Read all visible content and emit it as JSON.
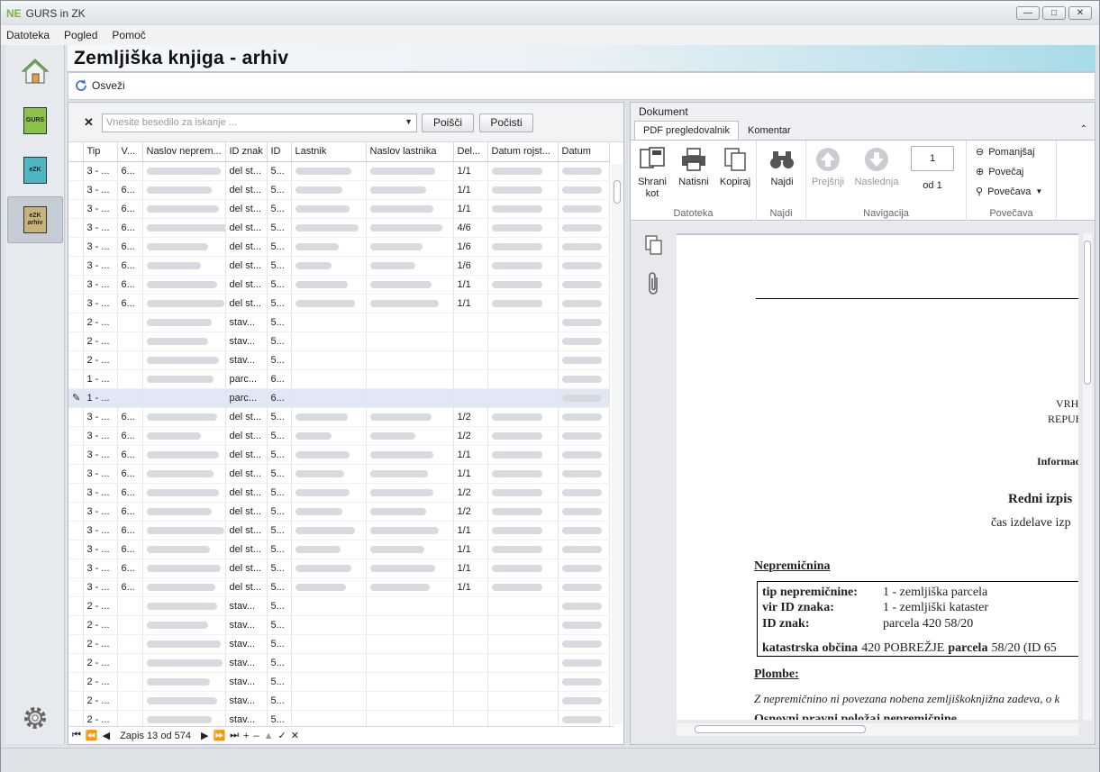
{
  "app": {
    "logo": "NE",
    "title": "GURS in ZK"
  },
  "menu": [
    "Datoteka",
    "Pogled",
    "Pomoč"
  ],
  "nav": {
    "gurs": "GURS",
    "ezk": "eZK",
    "ezk_arhiv_1": "eZK",
    "ezk_arhiv_2": "arhiv"
  },
  "page_title": "Zemljiška knjiga - arhiv",
  "toolbar": {
    "refresh": "Osveži"
  },
  "search": {
    "placeholder": "Vnesite besedilo za iskanje ...",
    "find": "Poišči",
    "clear": "Počisti"
  },
  "table": {
    "columns": [
      "Tip",
      "V...",
      "Naslov neprem...",
      "ID znak",
      "ID",
      "Lastnik",
      "Naslov lastnika",
      "Del...",
      "Datum rojst...",
      "Datum"
    ],
    "rows": [
      [
        "3 - ...",
        "6...",
        "del st...",
        "5...",
        "1/1"
      ],
      [
        "3 - ...",
        "6...",
        "del st...",
        "5...",
        "1/1"
      ],
      [
        "3 - ...",
        "6...",
        "del st...",
        "5...",
        "1/1"
      ],
      [
        "3 - ...",
        "6...",
        "del st...",
        "5...",
        "4/6"
      ],
      [
        "3 - ...",
        "6...",
        "del st...",
        "5...",
        "1/6"
      ],
      [
        "3 - ...",
        "6...",
        "del st...",
        "5...",
        "1/6"
      ],
      [
        "3 - ...",
        "6...",
        "del st...",
        "5...",
        "1/1"
      ],
      [
        "3 - ...",
        "6...",
        "del st...",
        "5...",
        "1/1"
      ],
      [
        "2 - ...",
        "",
        "stav...",
        "5...",
        ""
      ],
      [
        "2 - ...",
        "",
        "stav...",
        "5...",
        ""
      ],
      [
        "2 - ...",
        "",
        "stav...",
        "5...",
        ""
      ],
      [
        "1 - ...",
        "",
        "parc...",
        "6...",
        ""
      ],
      [
        "1 - ...",
        "",
        "parc...",
        "6...",
        ""
      ],
      [
        "3 - ...",
        "6...",
        "del st...",
        "5...",
        "1/2"
      ],
      [
        "3 - ...",
        "6...",
        "del st...",
        "5...",
        "1/2"
      ],
      [
        "3 - ...",
        "6...",
        "del st...",
        "5...",
        "1/1"
      ],
      [
        "3 - ...",
        "6...",
        "del st...",
        "5...",
        "1/1"
      ],
      [
        "3 - ...",
        "6...",
        "del st...",
        "5...",
        "1/2"
      ],
      [
        "3 - ...",
        "6...",
        "del st...",
        "5...",
        "1/2"
      ],
      [
        "3 - ...",
        "6...",
        "del st...",
        "5...",
        "1/1"
      ],
      [
        "3 - ...",
        "6...",
        "del st...",
        "5...",
        "1/1"
      ],
      [
        "3 - ...",
        "6...",
        "del st...",
        "5...",
        "1/1"
      ],
      [
        "3 - ...",
        "6...",
        "del st...",
        "5...",
        "1/1"
      ],
      [
        "2 - ...",
        "",
        "stav...",
        "5...",
        ""
      ],
      [
        "2 - ...",
        "",
        "stav...",
        "5...",
        ""
      ],
      [
        "2 - ...",
        "",
        "stav...",
        "5...",
        ""
      ],
      [
        "2 - ...",
        "",
        "stav...",
        "5...",
        ""
      ],
      [
        "2 - ...",
        "",
        "stav...",
        "5...",
        ""
      ],
      [
        "2 - ...",
        "",
        "stav...",
        "5...",
        ""
      ],
      [
        "2 - ...",
        "",
        "stav...",
        "5...",
        ""
      ]
    ],
    "navigator": "Zapis 13 od 574"
  },
  "document": {
    "label": "Dokument",
    "tabs": [
      "PDF pregledovalnik",
      "Komentar"
    ],
    "ribbon": {
      "save": "Shrani kot",
      "print": "Natisni",
      "copy": "Kopiraj",
      "find": "Najdi",
      "prev": "Prejšnji",
      "next": "Naslednja",
      "page": "1",
      "of": "od 1",
      "zoom_out": "Pomanjšaj",
      "zoom_in": "Povečaj",
      "zoom": "Povečava",
      "groups": [
        "Datoteka",
        "Najdi",
        "Navigacija",
        "Povečava"
      ]
    },
    "pdf": {
      "vrh": "VRHO",
      "repub": "REPUB",
      "informa": "Informac",
      "redni": "Redni izpis",
      "cas": "čas izdelave izp",
      "nepremicnina": "Nepremičnina",
      "tip_label": "tip nepremičnine:",
      "tip_value": "1 - zemljiška parcela",
      "vir_label": "vir ID znaka:",
      "vir_value": "1 - zemljiški kataster",
      "id_label": "ID znak:",
      "id_value": "parcela 420 58/20",
      "ko_label": "katastrska občina",
      "ko_value": "420 POBREŽJE",
      "parc_label": "parcela",
      "parc_value": "58/20 (ID 65",
      "plombe": "Plombe:",
      "plombe_text": "Z nepremičnino ni povezana nobena zemljiškoknjižna zadeva, o k",
      "last": "Osnovni pravni položaj nepremičnine"
    }
  }
}
